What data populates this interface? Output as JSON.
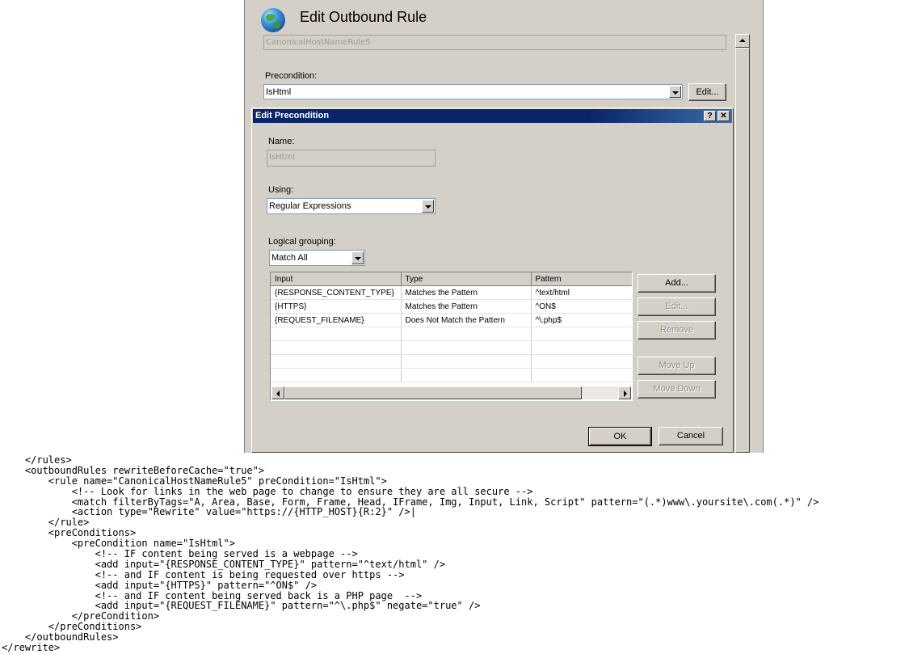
{
  "outbound_rule": {
    "title": "Edit Outbound Rule",
    "rule_name": "CanonicalHostNameRule5",
    "precondition_label": "Precondition:",
    "precondition_value": "IsHtml",
    "edit_button": "Edit..."
  },
  "precondition_dialog": {
    "title": "Edit Precondition",
    "help_button": "?",
    "close_button": "✕",
    "name_label": "Name:",
    "name_value": "IsHtml",
    "using_label": "Using:",
    "using_value": "Regular Expressions",
    "grouping_label": "Logical grouping:",
    "grouping_value": "Match All",
    "columns": [
      "Input",
      "Type",
      "Pattern"
    ],
    "rows": [
      {
        "input": "{RESPONSE_CONTENT_TYPE}",
        "type": "Matches the Pattern",
        "pattern": "^text/html"
      },
      {
        "input": "{HTTPS}",
        "type": "Matches the Pattern",
        "pattern": "^ON$"
      },
      {
        "input": "{REQUEST_FILENAME}",
        "type": "Does Not Match the Pattern",
        "pattern": "^\\.php$"
      }
    ],
    "buttons": {
      "add": "Add...",
      "edit": "Edit...",
      "remove": "Remove",
      "move_up": "Move Up",
      "move_down": "Move Down",
      "ok": "OK",
      "cancel": "Cancel"
    }
  },
  "code_lines": [
    "    </rules>",
    "    <outboundRules rewriteBeforeCache=\"true\">",
    "        <rule name=\"CanonicalHostNameRule5\" preCondition=\"IsHtml\">",
    "            <!-- Look for links in the web page to change to ensure they are all secure -->",
    "            <match filterByTags=\"A, Area, Base, Form, Frame, Head, IFrame, Img, Input, Link, Script\" pattern=\"(.*)www\\.yoursite\\.com(.*)\" />",
    "            <action type=\"Rewrite\" value=\"https://{HTTP_HOST}{R:2}\" />|",
    "        </rule>",
    "        <preConditions>",
    "            <preCondition name=\"IsHtml\">",
    "                <!-- IF content being served is a webpage -->",
    "                <add input=\"{RESPONSE_CONTENT_TYPE}\" pattern=\"^text/html\" />",
    "                <!-- and IF content is being requested over https -->",
    "                <add input=\"{HTTPS}\" pattern=\"^ON$\" />",
    "                <!-- and IF content being served back is a PHP page  -->",
    "                <add input=\"{REQUEST_FILENAME}\" pattern=\"^\\.php$\" negate=\"true\" />",
    "            </preCondition>",
    "        </preConditions>",
    "    </outboundRules>",
    "</rewrite>"
  ]
}
